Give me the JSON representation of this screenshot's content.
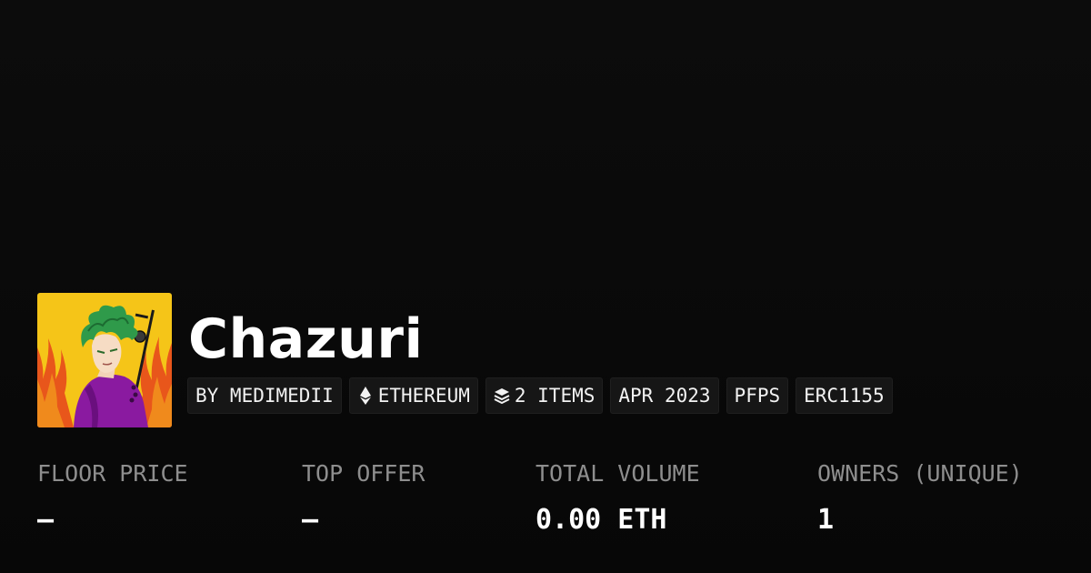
{
  "collection": {
    "name": "Chazuri",
    "avatar_icon": "anime-character-pfp-image",
    "tags": [
      {
        "label": "BY MEDIMEDII",
        "icon": ""
      },
      {
        "label": "ETHEREUM",
        "icon": "ethereum-icon"
      },
      {
        "label": "2 ITEMS",
        "icon": "layers-icon"
      },
      {
        "label": "APR 2023",
        "icon": ""
      },
      {
        "label": "PFPS",
        "icon": ""
      },
      {
        "label": "ERC1155",
        "icon": ""
      }
    ]
  },
  "stats": [
    {
      "label": "FLOOR PRICE",
      "value": "–"
    },
    {
      "label": "TOP OFFER",
      "value": "–"
    },
    {
      "label": "TOTAL VOLUME",
      "value": "0.00 ETH"
    },
    {
      "label": "OWNERS (UNIQUE)",
      "value": "1"
    }
  ],
  "colors": {
    "background": "#0a0a0a",
    "tag_background": "#161616",
    "label_gray": "#8e8e8e",
    "text": "#ffffff"
  }
}
